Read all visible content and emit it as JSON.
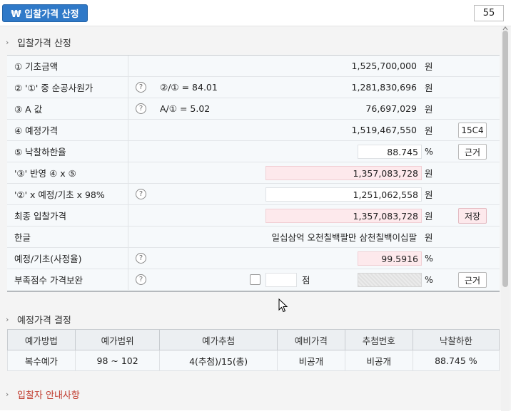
{
  "top": {
    "main_button_label": "₩ 입찰가격 산정",
    "page_number": "55"
  },
  "sections": {
    "bid_price": "입찰가격 산정",
    "estimate_price": "예정가격 결정",
    "bidder_info": "입찰자 안내사항"
  },
  "rows": [
    {
      "label": "① 기초금액",
      "formula": "",
      "value": "1,525,700,000",
      "unit": "원",
      "button": ""
    },
    {
      "label": "② '①' 중 순공사원가",
      "formula": "②/① = 84.01",
      "value": "1,281,830,696",
      "unit": "원",
      "button": ""
    },
    {
      "label": "③ A 값",
      "formula": "A/① = 5.02",
      "value": "76,697,029",
      "unit": "원",
      "button": ""
    },
    {
      "label": "④ 예정가격",
      "formula": "",
      "value": "1,519,467,550",
      "unit": "원",
      "button": "15C4"
    },
    {
      "label": "⑤ 낙찰하한율",
      "formula": "",
      "value": "88.745",
      "unit": "%",
      "button": "근거"
    },
    {
      "label": "'③' 반영 ④ x ⑤",
      "formula": "",
      "value": "1,357,083,728",
      "unit": "원",
      "button": ""
    },
    {
      "label": "'②' x 예정/기초 x 98%",
      "formula": "",
      "value": "1,251,062,558",
      "unit": "원",
      "button": ""
    },
    {
      "label": "최종 입찰가격",
      "formula": "",
      "value": "1,357,083,728",
      "unit": "원",
      "button": "저장"
    },
    {
      "label": "한글",
      "formula": "",
      "value": "일십삼억 오천칠백팔만 삼천칠백이십팔",
      "unit": "원",
      "button": ""
    },
    {
      "label": "예정/기초(사정율)",
      "formula": "",
      "value": "99.5916",
      "unit": "%",
      "button": ""
    },
    {
      "label": "부족점수 가격보완",
      "formula": "",
      "value": "",
      "unit": "%",
      "button": "근거",
      "score_unit": "점"
    }
  ],
  "help_symbol": "?",
  "estimate_table": {
    "headers": [
      "예가방법",
      "예가범위",
      "예가추첨",
      "예비가격",
      "추첨번호",
      "낙찰하한"
    ],
    "values": [
      "복수예가",
      "98 ~ 102",
      "4(추첨)/15(총)",
      "비공개",
      "비공개",
      "88.745 %"
    ]
  }
}
